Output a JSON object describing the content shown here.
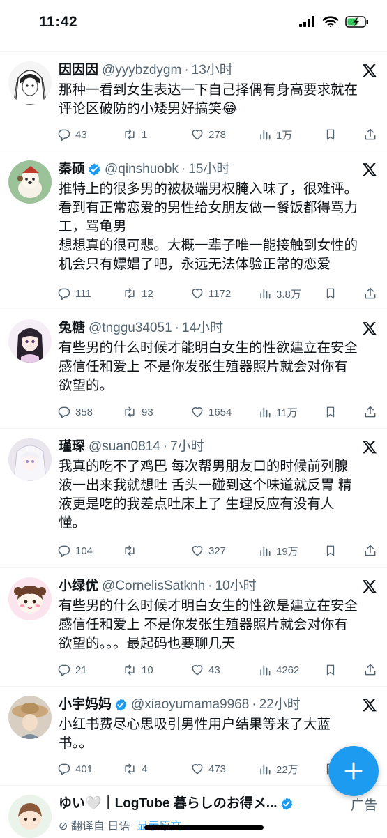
{
  "status_bar": {
    "time": "11:42"
  },
  "tweets": [
    {
      "name": "因因因",
      "handle": "@yyybzdygm",
      "time": "13小时",
      "verified": false,
      "lines": [
        "那种一看到女生表达一下自己择偶有身高要求就在",
        "评论区破防的小矮男好搞笑😂"
      ],
      "replies": "43",
      "retweets": "1",
      "likes": "278",
      "views": "1万"
    },
    {
      "name": "秦硕",
      "handle": "@qinshuobk",
      "time": "15小时",
      "verified": true,
      "lines": [
        "推特上的很多男的被极端男权腌入味了，很难评。",
        "看到有正常恋爱的男性给女朋友做一餐饭都得骂力",
        "工，骂龟男",
        "想想真的很可悲。大概一辈子唯一能接触到女性的",
        "机会只有嫖娼了吧，永远无法体验正常的恋爱"
      ],
      "replies": "111",
      "retweets": "12",
      "likes": "1172",
      "views": "3.8万"
    },
    {
      "name": "兔糖",
      "handle": "@tnggu34051",
      "time": "14小时",
      "verified": false,
      "lines": [
        "有些男的什么时候才能明白女生的性欲建立在安全",
        "感信任和爱上 不是你发张生殖器照片就会对你有",
        "欲望的。"
      ],
      "replies": "358",
      "retweets": "93",
      "likes": "1654",
      "views": "11万"
    },
    {
      "name": "瑾琛",
      "handle": "@suan0814",
      "time": "7小时",
      "verified": false,
      "lines": [
        "我真的吃不了鸡巴 每次帮男朋友口的时候前列腺",
        "液一出来我就想吐 舌头一碰到这个味道就反胃 精",
        "液更是吃的我差点吐床上了 生理反应有没有人",
        "懂。"
      ],
      "replies": "104",
      "retweets": "",
      "likes": "327",
      "views": "19万"
    },
    {
      "name": "小绿优",
      "handle": "@CornelisSatknh",
      "time": "10小时",
      "verified": false,
      "lines": [
        "有些男的什么时候才明白女生的性欲是建立在安全",
        "感信任和爱上 不是你发张生殖器照片就会对你有",
        "欲望的。。。最起码也要聊几天"
      ],
      "replies": "21",
      "retweets": "10",
      "likes": "43",
      "views": "4262"
    },
    {
      "name": "小宇妈妈",
      "handle": "@xiaoyumama9968",
      "time": "22小时",
      "verified": true,
      "lines": [
        "小红书费尽心思吸引男性用户结果等来了大蓝",
        "书。。"
      ],
      "replies": "401",
      "retweets": "4",
      "likes": "473",
      "views": "22万"
    }
  ],
  "ad_tweet": {
    "name": "ゆい🤍｜LogTube 暮らしのお得メ...",
    "ad_label": "广告",
    "translate_text": "翻译自 日语",
    "show_original": "显示原文"
  }
}
